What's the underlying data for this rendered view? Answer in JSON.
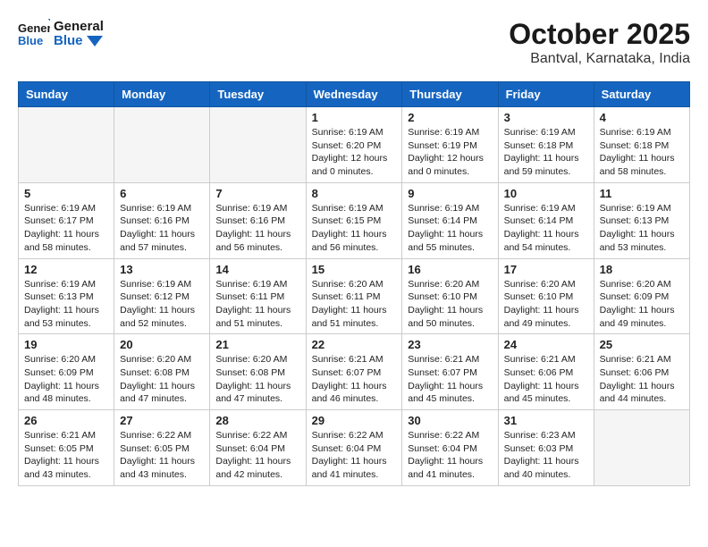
{
  "header": {
    "logo_general": "General",
    "logo_blue": "Blue",
    "title": "October 2025",
    "subtitle": "Bantval, Karnataka, India"
  },
  "weekdays": [
    "Sunday",
    "Monday",
    "Tuesday",
    "Wednesday",
    "Thursday",
    "Friday",
    "Saturday"
  ],
  "weeks": [
    [
      {
        "day": "",
        "info": ""
      },
      {
        "day": "",
        "info": ""
      },
      {
        "day": "",
        "info": ""
      },
      {
        "day": "1",
        "info": "Sunrise: 6:19 AM\nSunset: 6:20 PM\nDaylight: 12 hours\nand 0 minutes."
      },
      {
        "day": "2",
        "info": "Sunrise: 6:19 AM\nSunset: 6:19 PM\nDaylight: 12 hours\nand 0 minutes."
      },
      {
        "day": "3",
        "info": "Sunrise: 6:19 AM\nSunset: 6:18 PM\nDaylight: 11 hours\nand 59 minutes."
      },
      {
        "day": "4",
        "info": "Sunrise: 6:19 AM\nSunset: 6:18 PM\nDaylight: 11 hours\nand 58 minutes."
      }
    ],
    [
      {
        "day": "5",
        "info": "Sunrise: 6:19 AM\nSunset: 6:17 PM\nDaylight: 11 hours\nand 58 minutes."
      },
      {
        "day": "6",
        "info": "Sunrise: 6:19 AM\nSunset: 6:16 PM\nDaylight: 11 hours\nand 57 minutes."
      },
      {
        "day": "7",
        "info": "Sunrise: 6:19 AM\nSunset: 6:16 PM\nDaylight: 11 hours\nand 56 minutes."
      },
      {
        "day": "8",
        "info": "Sunrise: 6:19 AM\nSunset: 6:15 PM\nDaylight: 11 hours\nand 56 minutes."
      },
      {
        "day": "9",
        "info": "Sunrise: 6:19 AM\nSunset: 6:14 PM\nDaylight: 11 hours\nand 55 minutes."
      },
      {
        "day": "10",
        "info": "Sunrise: 6:19 AM\nSunset: 6:14 PM\nDaylight: 11 hours\nand 54 minutes."
      },
      {
        "day": "11",
        "info": "Sunrise: 6:19 AM\nSunset: 6:13 PM\nDaylight: 11 hours\nand 53 minutes."
      }
    ],
    [
      {
        "day": "12",
        "info": "Sunrise: 6:19 AM\nSunset: 6:13 PM\nDaylight: 11 hours\nand 53 minutes."
      },
      {
        "day": "13",
        "info": "Sunrise: 6:19 AM\nSunset: 6:12 PM\nDaylight: 11 hours\nand 52 minutes."
      },
      {
        "day": "14",
        "info": "Sunrise: 6:19 AM\nSunset: 6:11 PM\nDaylight: 11 hours\nand 51 minutes."
      },
      {
        "day": "15",
        "info": "Sunrise: 6:20 AM\nSunset: 6:11 PM\nDaylight: 11 hours\nand 51 minutes."
      },
      {
        "day": "16",
        "info": "Sunrise: 6:20 AM\nSunset: 6:10 PM\nDaylight: 11 hours\nand 50 minutes."
      },
      {
        "day": "17",
        "info": "Sunrise: 6:20 AM\nSunset: 6:10 PM\nDaylight: 11 hours\nand 49 minutes."
      },
      {
        "day": "18",
        "info": "Sunrise: 6:20 AM\nSunset: 6:09 PM\nDaylight: 11 hours\nand 49 minutes."
      }
    ],
    [
      {
        "day": "19",
        "info": "Sunrise: 6:20 AM\nSunset: 6:09 PM\nDaylight: 11 hours\nand 48 minutes."
      },
      {
        "day": "20",
        "info": "Sunrise: 6:20 AM\nSunset: 6:08 PM\nDaylight: 11 hours\nand 47 minutes."
      },
      {
        "day": "21",
        "info": "Sunrise: 6:20 AM\nSunset: 6:08 PM\nDaylight: 11 hours\nand 47 minutes."
      },
      {
        "day": "22",
        "info": "Sunrise: 6:21 AM\nSunset: 6:07 PM\nDaylight: 11 hours\nand 46 minutes."
      },
      {
        "day": "23",
        "info": "Sunrise: 6:21 AM\nSunset: 6:07 PM\nDaylight: 11 hours\nand 45 minutes."
      },
      {
        "day": "24",
        "info": "Sunrise: 6:21 AM\nSunset: 6:06 PM\nDaylight: 11 hours\nand 45 minutes."
      },
      {
        "day": "25",
        "info": "Sunrise: 6:21 AM\nSunset: 6:06 PM\nDaylight: 11 hours\nand 44 minutes."
      }
    ],
    [
      {
        "day": "26",
        "info": "Sunrise: 6:21 AM\nSunset: 6:05 PM\nDaylight: 11 hours\nand 43 minutes."
      },
      {
        "day": "27",
        "info": "Sunrise: 6:22 AM\nSunset: 6:05 PM\nDaylight: 11 hours\nand 43 minutes."
      },
      {
        "day": "28",
        "info": "Sunrise: 6:22 AM\nSunset: 6:04 PM\nDaylight: 11 hours\nand 42 minutes."
      },
      {
        "day": "29",
        "info": "Sunrise: 6:22 AM\nSunset: 6:04 PM\nDaylight: 11 hours\nand 41 minutes."
      },
      {
        "day": "30",
        "info": "Sunrise: 6:22 AM\nSunset: 6:04 PM\nDaylight: 11 hours\nand 41 minutes."
      },
      {
        "day": "31",
        "info": "Sunrise: 6:23 AM\nSunset: 6:03 PM\nDaylight: 11 hours\nand 40 minutes."
      },
      {
        "day": "",
        "info": ""
      }
    ]
  ]
}
